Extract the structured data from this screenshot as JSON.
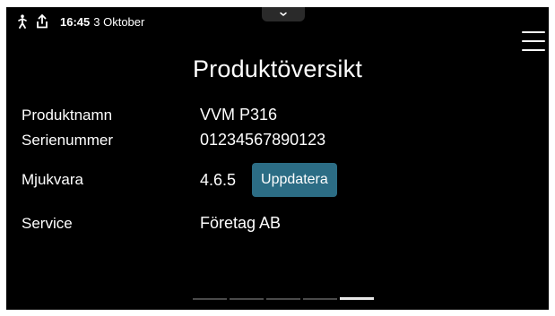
{
  "status_bar": {
    "icons": [
      "person-walking-icon",
      "share-upload-icon"
    ],
    "time": "16:45",
    "date": "3 Oktober"
  },
  "header": {
    "pulldown_icon": "chevron-down-icon",
    "menu_icon": "hamburger-menu-icon",
    "title": "Produktöversikt"
  },
  "product": {
    "rows": [
      {
        "label": "Produktnamn",
        "value": "VVM P316"
      },
      {
        "label": "Serienummer",
        "value": "01234567890123"
      },
      {
        "label": "Mjukvara",
        "value": "4.6.5",
        "action": "Uppdatera"
      },
      {
        "label": "Service",
        "value": "Företag AB"
      }
    ]
  },
  "pager": {
    "page_count": 5,
    "active_index": 4
  },
  "colors": {
    "background": "#000000",
    "text": "#ffffff",
    "accent_button": "#2c6d85"
  }
}
